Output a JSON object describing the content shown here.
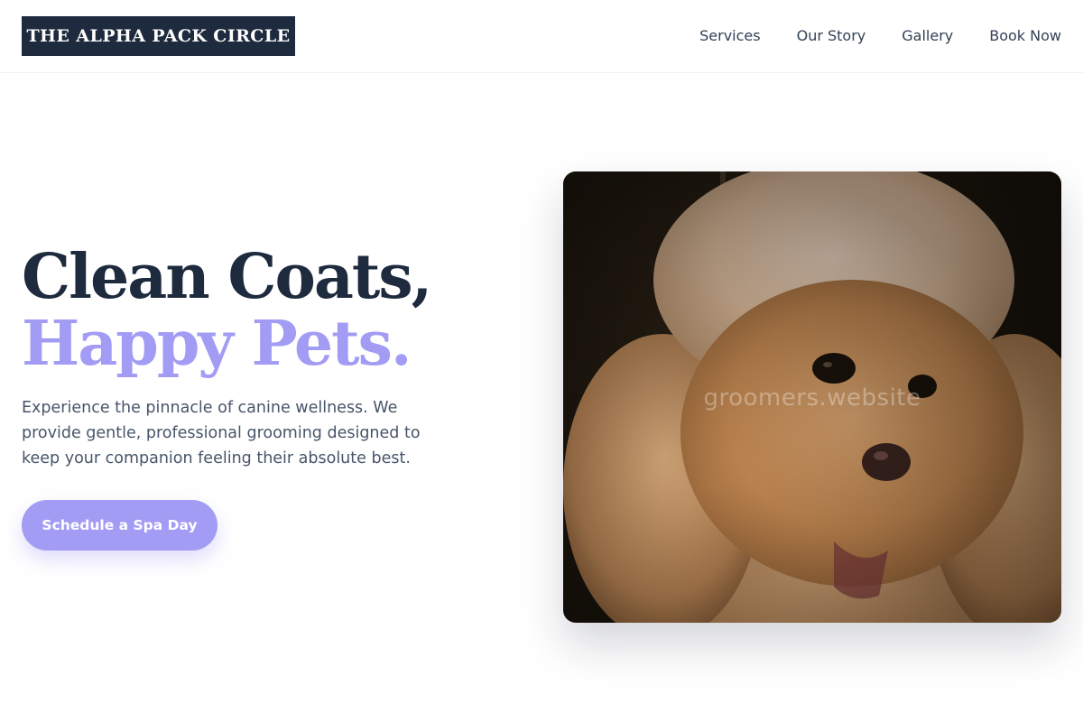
{
  "brand": {
    "name": "THE ALPHA PACK CIRCLE"
  },
  "nav": {
    "items": [
      {
        "label": "Services"
      },
      {
        "label": "Our Story"
      },
      {
        "label": "Gallery"
      },
      {
        "label": "Book Now"
      }
    ]
  },
  "hero": {
    "title_line1": "Clean Coats,",
    "title_line2": "Happy Pets.",
    "description": "Experience the pinnacle of canine wellness. We provide gentle, professional grooming designed to keep your companion feeling their absolute best.",
    "cta_label": "Schedule a Spa Day",
    "image": {
      "subject": "fluffy apricot poodle",
      "watermark": "groomers.website"
    }
  },
  "colors": {
    "brand_navy": "#1e2a3d",
    "accent_lavender": "#a39cf4",
    "body_text": "#475569",
    "nav_text": "#334155"
  }
}
